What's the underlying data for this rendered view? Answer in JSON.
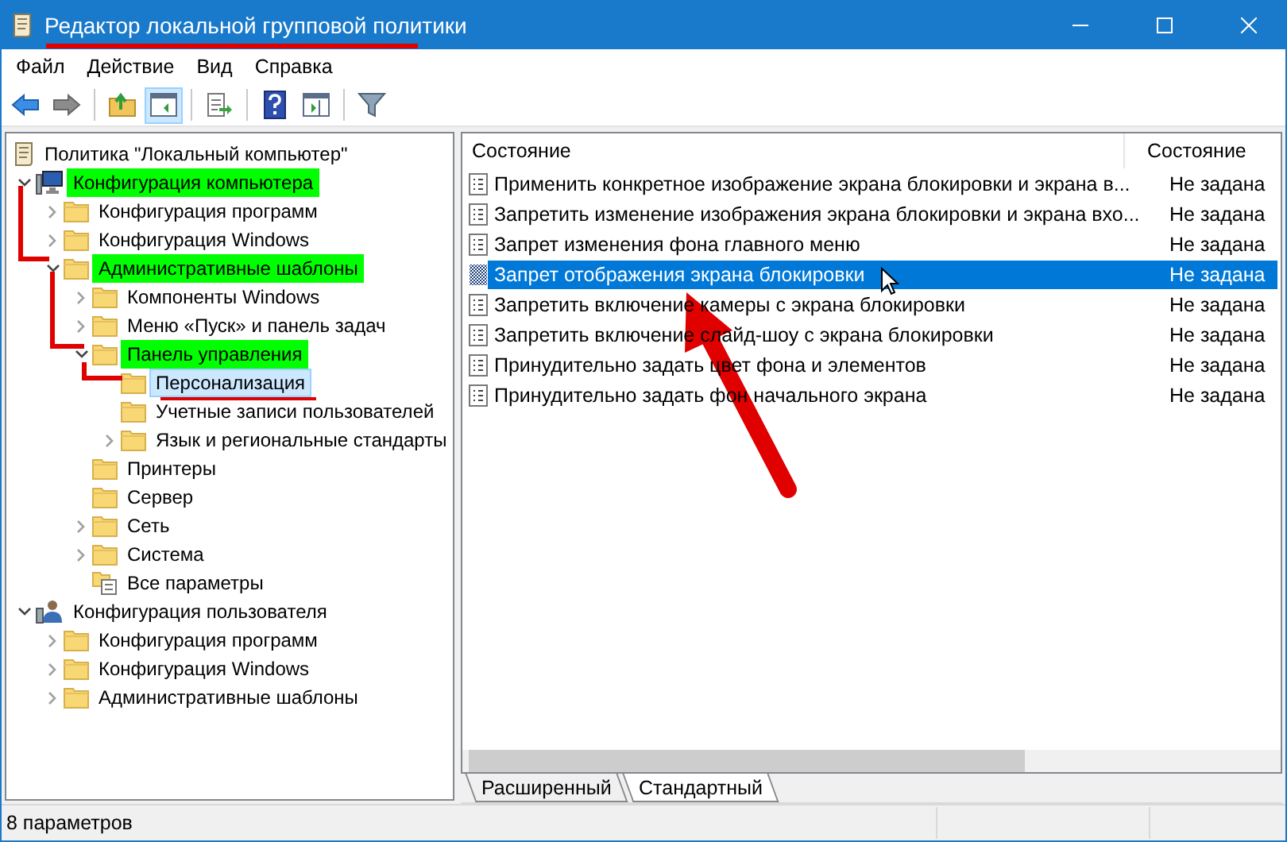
{
  "window": {
    "title": "Редактор локальной групповой политики"
  },
  "menu": [
    "Файл",
    "Действие",
    "Вид",
    "Справка"
  ],
  "toolbar": [
    {
      "kind": "back",
      "disabled": false,
      "pressed": false
    },
    {
      "kind": "forward",
      "disabled": true,
      "pressed": false
    },
    {
      "kind": "separator"
    },
    {
      "kind": "up",
      "pressed": false
    },
    {
      "kind": "tree",
      "pressed": true
    },
    {
      "kind": "separator"
    },
    {
      "kind": "export",
      "pressed": false
    },
    {
      "kind": "separator"
    },
    {
      "kind": "help",
      "pressed": false
    },
    {
      "kind": "pane",
      "pressed": false
    },
    {
      "kind": "separator"
    },
    {
      "kind": "filter",
      "pressed": false
    }
  ],
  "tree": {
    "label": "Политика \"Локальный компьютер\"",
    "kind": "policy",
    "children": [
      {
        "label": "Конфигурация компьютера",
        "kind": "computer",
        "expanded": true,
        "selected": false,
        "highlighted": true,
        "children": [
          {
            "label": "Конфигурация программ",
            "kind": "folder",
            "expanded": false,
            "selected": false,
            "highlighted": false
          },
          {
            "label": "Конфигурация Windows",
            "kind": "folder",
            "expanded": false,
            "selected": false,
            "highlighted": false
          },
          {
            "label": "Административные шаблоны",
            "kind": "folder",
            "expanded": true,
            "selected": false,
            "highlighted": true,
            "children": [
              {
                "label": "Компоненты Windows",
                "kind": "folder",
                "expanded": false,
                "selected": false,
                "highlighted": false
              },
              {
                "label": "Меню «Пуск» и панель задач",
                "kind": "folder",
                "expanded": false,
                "selected": false,
                "highlighted": false
              },
              {
                "label": "Панель управления",
                "kind": "folder",
                "expanded": true,
                "selected": false,
                "highlighted": true,
                "children": [
                  {
                    "label": "Персонализация",
                    "kind": "folder",
                    "selected": true,
                    "highlighted": false
                  },
                  {
                    "label": "Учетные записи пользователей",
                    "kind": "folder",
                    "selected": false,
                    "highlighted": false
                  },
                  {
                    "label": "Язык и региональные стандарты",
                    "kind": "folder",
                    "expanded": false,
                    "selected": false,
                    "highlighted": false
                  }
                ]
              },
              {
                "label": "Принтеры",
                "kind": "folder",
                "selected": false,
                "highlighted": false
              },
              {
                "label": "Сервер",
                "kind": "folder",
                "selected": false,
                "highlighted": false
              },
              {
                "label": "Сеть",
                "kind": "folder",
                "expanded": false,
                "selected": false,
                "highlighted": false
              },
              {
                "label": "Система",
                "kind": "folder",
                "expanded": false,
                "selected": false,
                "highlighted": false
              },
              {
                "label": "Все параметры",
                "kind": "settings",
                "selected": false,
                "highlighted": false
              }
            ]
          }
        ]
      },
      {
        "label": "Конфигурация пользователя",
        "kind": "user",
        "expanded": true,
        "selected": false,
        "highlighted": false,
        "children": [
          {
            "label": "Конфигурация программ",
            "kind": "folder",
            "expanded": false,
            "selected": false,
            "highlighted": false
          },
          {
            "label": "Конфигурация Windows",
            "kind": "folder",
            "expanded": false,
            "selected": false,
            "highlighted": false
          },
          {
            "label": "Административные шаблоны",
            "kind": "folder",
            "expanded": false,
            "selected": false,
            "highlighted": false
          }
        ]
      }
    ]
  },
  "list": {
    "columns": [
      "Состояние",
      "Состояние"
    ],
    "rows": [
      {
        "name": "Применить конкретное изображение экрана блокировки и экрана в...",
        "state": "Не задана",
        "selected": false
      },
      {
        "name": "Запретить изменение изображения экрана блокировки и экрана вхо...",
        "state": "Не задана",
        "selected": false
      },
      {
        "name": "Запрет изменения фона главного меню",
        "state": "Не задана",
        "selected": false
      },
      {
        "name": "Запрет отображения экрана блокировки",
        "state": "Не задана",
        "selected": true
      },
      {
        "name": "Запретить включение камеры с экрана блокировки",
        "state": "Не задана",
        "selected": false
      },
      {
        "name": "Запретить включение слайд-шоу с экрана блокировки",
        "state": "Не задана",
        "selected": false
      },
      {
        "name": "Принудительно задать цвет фона и элементов",
        "state": "Не задана",
        "selected": false
      },
      {
        "name": "Принудительно задать фон начального экрана",
        "state": "Не задана",
        "selected": false
      }
    ]
  },
  "view_tabs": [
    {
      "label": "Расширенный",
      "selected": false
    },
    {
      "label": "Стандартный",
      "selected": true
    }
  ],
  "status_bar": "8 параметров"
}
